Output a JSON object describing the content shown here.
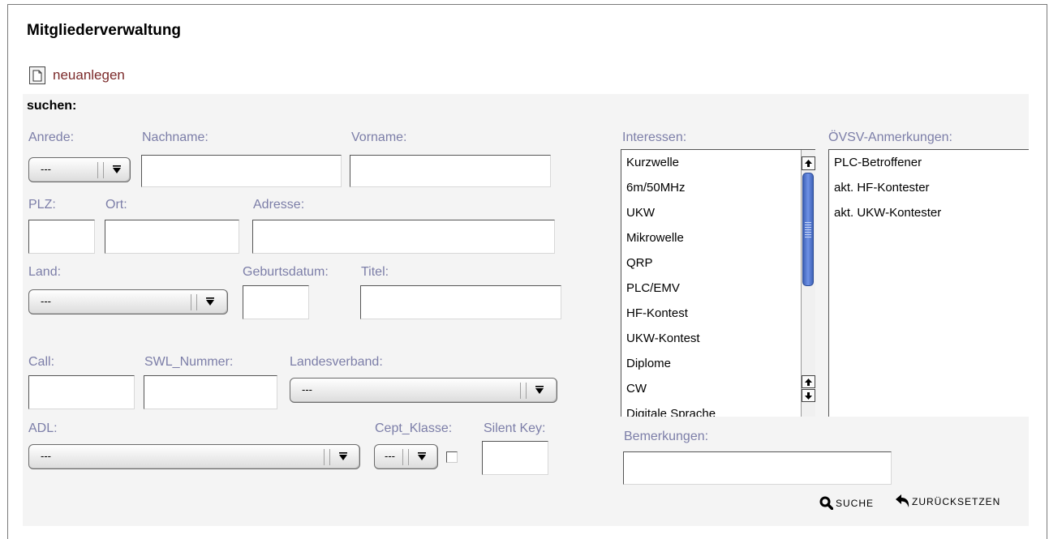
{
  "page": {
    "title": "Mitgliederverwaltung"
  },
  "toolbar": {
    "new_label": "neuanlegen",
    "new_icon": "document-icon"
  },
  "search": {
    "heading": "suchen:",
    "labels": {
      "anrede": "Anrede:",
      "nachname": "Nachname:",
      "vorname": "Vorname:",
      "plz": "PLZ:",
      "ort": "Ort:",
      "adresse": "Adresse:",
      "land": "Land:",
      "geburtsdatum": "Geburtsdatum:",
      "titel": "Titel:",
      "call": "Call:",
      "swl": "SWL_Nummer:",
      "landesverband": "Landesverband:",
      "adl": "ADL:",
      "cept": "Cept_Klasse:",
      "silent_key": "Silent Key:",
      "interessen": "Interessen:",
      "oevsv": "ÖVSV-Anmerkungen:",
      "bemerkungen": "Bemerkungen:"
    },
    "selects": {
      "anrede": "---",
      "land": "---",
      "landesverband": "---",
      "adl": "---",
      "cept": "---"
    },
    "inputs": {
      "nachname": "",
      "vorname": "",
      "plz": "",
      "ort": "",
      "adresse": "",
      "geburtsdatum": "",
      "titel": "",
      "call": "",
      "swl": "",
      "silent_key": "",
      "bemerkungen": ""
    },
    "silent_key_checked": false,
    "interessen_items": [
      "Kurzwelle",
      "6m/50MHz",
      "UKW",
      "Mikrowelle",
      "QRP",
      "PLC/EMV",
      "HF-Kontest",
      "UKW-Kontest",
      "Diplome",
      "CW",
      "Digitale Sprache"
    ],
    "oevsv_items": [
      "PLC-Betroffener",
      "akt. HF-Kontester",
      "akt. UKW-Kontester"
    ],
    "actions": {
      "search_label": "SUCHE",
      "search_icon": "magnifier-icon",
      "reset_label": "ZURÜCKSETZEN",
      "reset_icon": "undo-arrow-icon"
    }
  },
  "colors": {
    "label": "#7c7ea8",
    "link": "#7b2a2a",
    "panel": "#f4f4f4",
    "scroll_thumb": "#4a6fc8"
  }
}
